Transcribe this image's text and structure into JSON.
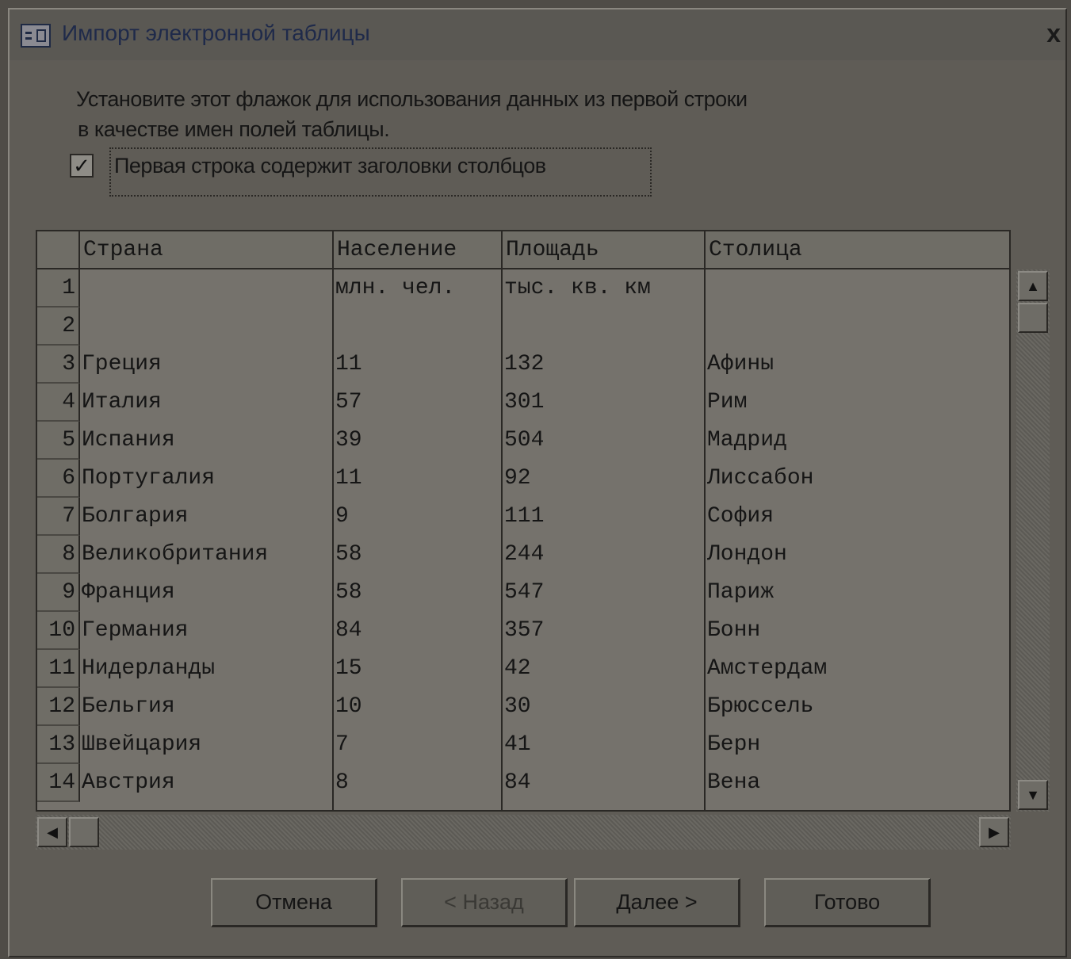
{
  "window": {
    "title": "Импорт электронной таблицы",
    "close_glyph": "x"
  },
  "instructions": {
    "line1": "Установите этот флажок для использования данных из первой строки",
    "line2": "в качестве имен  полей таблицы."
  },
  "first_row_checkbox": {
    "checked": true,
    "glyph": "✓",
    "label": "Первая строка содержит заголовки столбцов"
  },
  "table": {
    "columns": [
      "Страна",
      "Население",
      "Площадь",
      "Столица"
    ],
    "row_numbers": [
      "1",
      "2",
      "3",
      "4",
      "5",
      "6",
      "7",
      "8",
      "9",
      "10",
      "11",
      "12",
      "13",
      "14"
    ],
    "rows": [
      [
        "",
        "млн. чел.",
        "тыс. кв. км",
        ""
      ],
      [
        "",
        "",
        "",
        ""
      ],
      [
        "Греция",
        "11",
        "132",
        "Афины"
      ],
      [
        "Италия",
        "57",
        "301",
        "Рим"
      ],
      [
        "Испания",
        "39",
        "504",
        "Мадрид"
      ],
      [
        "Португалия",
        "11",
        "92",
        "Лиссабон"
      ],
      [
        "Болгария",
        "9",
        "111",
        "София"
      ],
      [
        "Великобритания",
        "58",
        "244",
        "Лондон"
      ],
      [
        "Франция",
        "58",
        "547",
        "Париж"
      ],
      [
        "Германия",
        "84",
        "357",
        "Бонн"
      ],
      [
        "Нидерланды",
        "15",
        "42",
        "Амстердам"
      ],
      [
        "Бельгия",
        "10",
        "30",
        "Брюссель"
      ],
      [
        "Швейцария",
        "7",
        "41",
        "Берн"
      ],
      [
        "Австрия",
        "8",
        "84",
        "Вена"
      ]
    ]
  },
  "scroll": {
    "up": "▲",
    "down": "▼",
    "left": "◀",
    "right": "▶"
  },
  "buttons": {
    "cancel": "Отмена",
    "back": "< Назад",
    "next": "Далее >",
    "finish": "Готово"
  },
  "colors": {
    "background": "#5f5c56",
    "title_text": "#1f2a4a",
    "grid": "#75726c"
  }
}
